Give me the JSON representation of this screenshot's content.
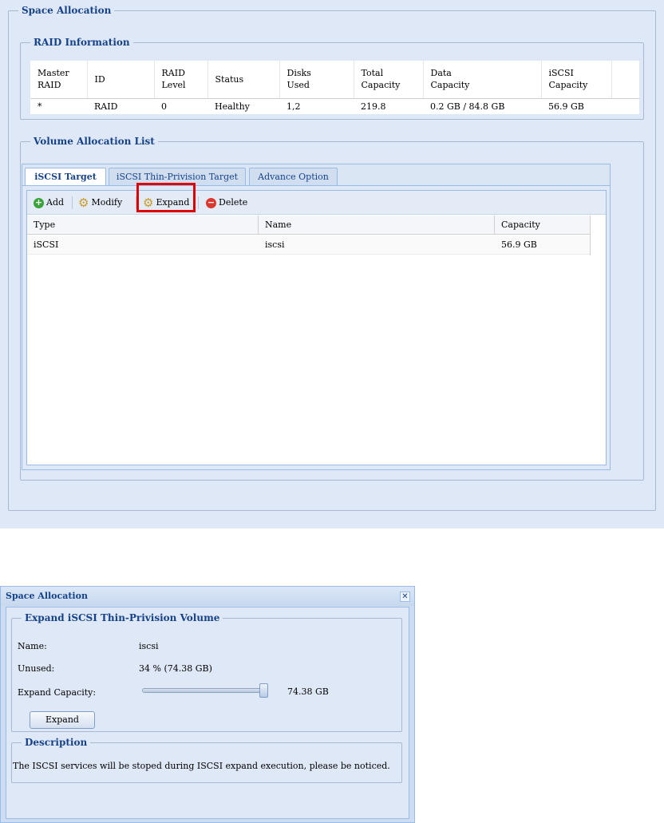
{
  "space_allocation": {
    "legend": "Space Allocation",
    "raid_info": {
      "legend": "RAID Information",
      "columns": [
        [
          "Master",
          "RAID"
        ],
        [
          "ID",
          ""
        ],
        [
          "RAID",
          "Level"
        ],
        [
          "Status",
          ""
        ],
        [
          "Disks",
          "Used"
        ],
        [
          "Total",
          "Capacity"
        ],
        [
          "Data",
          "Capacity"
        ],
        [
          "iSCSI",
          "Capacity"
        ]
      ],
      "row": [
        "*",
        "RAID",
        "0",
        "Healthy",
        "1,2",
        "219.8",
        "0.2 GB / 84.8 GB",
        "56.9 GB"
      ]
    },
    "volume_list": {
      "legend": "Volume Allocation List",
      "tabs": [
        "iSCSI Target",
        "iSCSI Thin-Privision Target",
        "Advance Option"
      ],
      "active_tab": 0,
      "toolbar": {
        "add": "Add",
        "modify": "Modify",
        "expand": "Expand",
        "delete": "Delete"
      },
      "columns": [
        "Type",
        "Name",
        "Capacity"
      ],
      "rows": [
        [
          "iSCSI",
          "iscsi",
          "56.9 GB"
        ]
      ]
    }
  },
  "dialog": {
    "title": "Space Allocation",
    "expand_section": {
      "legend": "Expand iSCSI Thin-Privision Volume",
      "name_label": "Name:",
      "name_value": "iscsi",
      "unused_label": "Unused:",
      "unused_value": "34 % (74.38 GB)",
      "capacity_label": "Expand Capacity:",
      "capacity_value": "74.38 GB",
      "slider_level": 1.0,
      "expand_button": "Expand"
    },
    "description": {
      "legend": "Description",
      "text": "The ISCSI services will be stoped during ISCSI expand execution, please be noticed."
    }
  },
  "colors": {
    "panel_bg": "#dfe8f6",
    "legend_text": "#15428b",
    "border": "#99bbe8",
    "highlight": "#e00000",
    "add_icon": "#3aa33a",
    "delete_icon": "#d9382e"
  },
  "icons": {
    "add": "plus-circle-icon",
    "modify": "gear-icon",
    "expand": "gear-icon",
    "delete": "minus-circle-icon",
    "close": "close-icon"
  }
}
